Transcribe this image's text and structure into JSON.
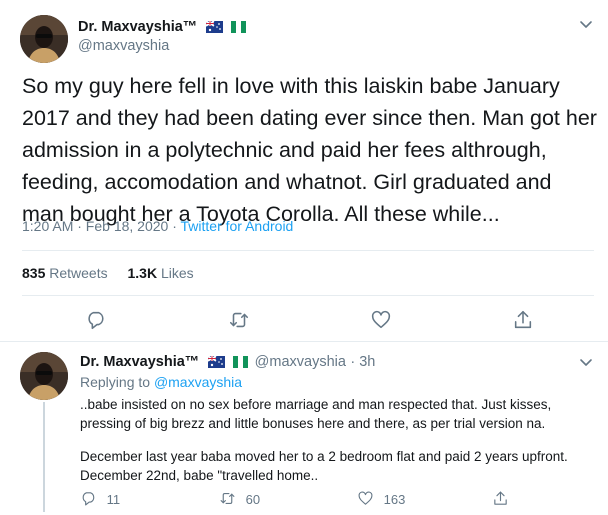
{
  "main_tweet": {
    "author_name": "Dr. Maxvayshia™",
    "author_handle": "@maxvayshia",
    "text": "So my guy here fell in love with this laiskin babe January 2017 and they had been dating ever since then. Man got her admission in a polytechnic and paid her fees althrough, feeding, accomodation and whatnot. Girl graduated and man bought her a Toyota Corolla. All these while...",
    "timestamp": "1:20 AM · Feb 18, 2020 · ",
    "source": "Twitter for Android",
    "retweets_count": "835",
    "retweets_label": "Retweets",
    "likes_count": "1.3K",
    "likes_label": "Likes"
  },
  "reply_tweet": {
    "author_name": "Dr. Maxvayshia™",
    "author_handle": "@maxvayshia",
    "age": "· 3h",
    "replying_to_label": "Replying to ",
    "replying_to_handle": "@maxvayshia",
    "paragraph_1": "..babe insisted on no sex before marriage and man respected that. Just kisses, pressing of big brezz and little bonuses here and there, as per trial version na.",
    "paragraph_2": "December last year baba moved her to a 2 bedroom flat and paid 2 years upfront. December 22nd, babe \"travelled home..",
    "reply_count": "11",
    "retweet_count": "60",
    "like_count": "163"
  },
  "icons": {
    "menu": "chevron-down-icon",
    "reply": "comment-icon",
    "retweet": "retweet-icon",
    "like": "heart-icon",
    "share": "share-icon",
    "flag_1": "australia-flag-icon",
    "flag_2": "nigeria-flag-icon"
  },
  "colors": {
    "link": "#1da1f2",
    "secondary_text": "#657786",
    "divider": "#e6ecf0"
  }
}
